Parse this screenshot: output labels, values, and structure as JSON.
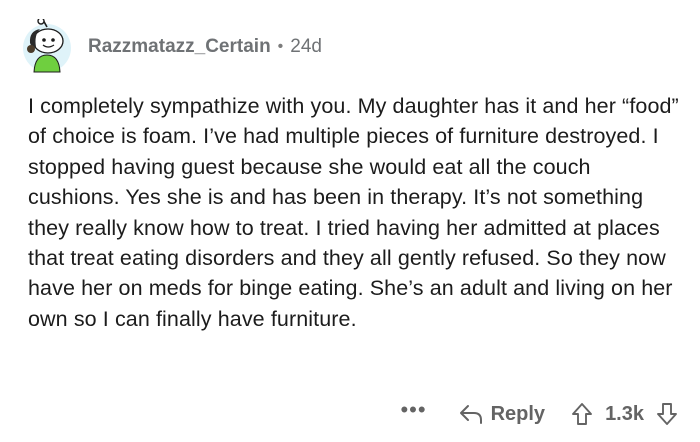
{
  "comment": {
    "author": "Razzmatazz_Certain",
    "separator": "•",
    "age": "24d",
    "body": "I completely sympathize with you. My daughter has it and her “food” of choice is foam. I’ve had multiple pieces of furniture destroyed. I stopped having guest because she would eat all the couch cushions. Yes she is and has been in therapy. It’s not something they really know how to treat. I tried having her admitted at places that treat eating disorders and they all gently refused. So they now have her on meds for binge eating. She’s an adult and living on her own so I can finally have furniture."
  },
  "actions": {
    "more_label": "•••",
    "reply_label": "Reply",
    "score": "1.3k"
  },
  "icons": {
    "avatar": "snoo-avatar",
    "reply": "reply-arrow-icon",
    "upvote": "upvote-arrow-icon",
    "downvote": "downvote-arrow-icon"
  },
  "colors": {
    "meta_text": "#6f7275",
    "body_text": "#1c1c1c",
    "action_text": "#646464",
    "avatar_bg": "#dff3f9",
    "avatar_shirt": "#6fcf3f"
  }
}
